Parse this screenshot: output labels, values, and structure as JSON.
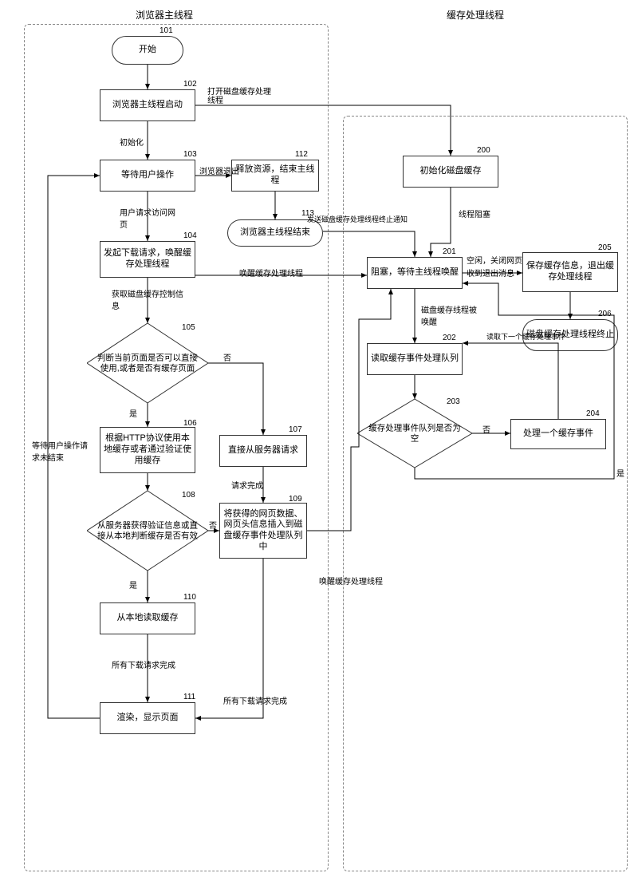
{
  "titles": {
    "left": "浏览器主线程",
    "right": "缓存处理线程"
  },
  "nodes": {
    "n101": "开始",
    "n102": "浏览器主线程启动",
    "n103": "等待用户操作",
    "n104": "发起下载请求，唤醒缓存处理线程",
    "n105": "判断当前页面是否可以直接使用,或者是否有缓存页面",
    "n106": "根据HTTP协议使用本地缓存或者通过验证使用缓存",
    "n107": "直接从服务器请求",
    "n108": "从服务器获得验证信息或直接从本地判断缓存是否有效",
    "n109": "将获得的网页数据、网页头信息插入到磁盘缓存事件处理队列中",
    "n110": "从本地读取缓存",
    "n111": "渲染，显示页面",
    "n112": "释放资源，结束主线程",
    "n113": "浏览器主线程结束",
    "n200": "初始化磁盘缓存",
    "n201": "阻塞，等待主线程唤醒",
    "n202": "读取缓存事件处理队列",
    "n203": "缓存处理事件队列是否为空",
    "n204": "处理一个缓存事件",
    "n205": "保存缓存信息，退出缓存处理线程",
    "n206": "磁盘缓存处理线程终止"
  },
  "nums": {
    "n101": "101",
    "n102": "102",
    "n103": "103",
    "n104": "104",
    "n105": "105",
    "n106": "106",
    "n107": "107",
    "n108": "108",
    "n109": "109",
    "n110": "110",
    "n111": "111",
    "n112": "112",
    "n113": "113",
    "n200": "200",
    "n201": "201",
    "n202": "202",
    "n203": "203",
    "n204": "204",
    "n205": "205",
    "n206": "206"
  },
  "edges": {
    "e_init": "初始化",
    "e_browser_exit": "浏览器退出",
    "e_open_cache_thread": "打开磁盘缓存处理线程",
    "e_user_req": "用户请求访问网页",
    "e_get_cache_ctrl": "获取磁盘缓存控制信息",
    "e_yes": "是",
    "e_no": "否",
    "e_req_done": "请求完成",
    "e_all_done1": "所有下载请求完成",
    "e_all_done2": "所有下载请求完成",
    "e_wait_user": "等待用户操作请求未结束",
    "e_thread_block": "线程阻塞",
    "e_free_close": "空闲，关闭网页",
    "e_recv_exit": "收到退出消息",
    "e_wake_handler": "唤醒缓存处理线程",
    "e_wake_handler2": "唤醒缓存处理线程",
    "e_send_exit": "发送磁盘缓存处理线程终止通知",
    "e_get_next": "读取下一个缓存处理事件",
    "e_cache_wake": "磁盘缓存线程被唤醒"
  },
  "chart_data": {
    "type": "flowchart-dual-swimlane",
    "swimlanes": [
      "浏览器主线程",
      "缓存处理线程"
    ],
    "nodes": [
      {
        "id": 101,
        "lane": 0,
        "type": "start",
        "label": "开始"
      },
      {
        "id": 102,
        "lane": 0,
        "type": "process",
        "label": "浏览器主线程启动"
      },
      {
        "id": 103,
        "lane": 0,
        "type": "process",
        "label": "等待用户操作"
      },
      {
        "id": 104,
        "lane": 0,
        "type": "process",
        "label": "发起下载请求，唤醒缓存处理线程"
      },
      {
        "id": 105,
        "lane": 0,
        "type": "decision",
        "label": "判断当前页面是否可以直接使用,或者是否有缓存页面"
      },
      {
        "id": 106,
        "lane": 0,
        "type": "process",
        "label": "根据HTTP协议使用本地缓存或者通过验证使用缓存"
      },
      {
        "id": 107,
        "lane": 0,
        "type": "process",
        "label": "直接从服务器请求"
      },
      {
        "id": 108,
        "lane": 0,
        "type": "decision",
        "label": "从服务器获得验证信息或直接从本地判断缓存是否有效"
      },
      {
        "id": 109,
        "lane": 0,
        "type": "process",
        "label": "将获得的网页数据、网页头信息插入到磁盘缓存事件处理队列中"
      },
      {
        "id": 110,
        "lane": 0,
        "type": "process",
        "label": "从本地读取缓存"
      },
      {
        "id": 111,
        "lane": 0,
        "type": "process",
        "label": "渲染，显示页面"
      },
      {
        "id": 112,
        "lane": 0,
        "type": "process",
        "label": "释放资源，结束主线程"
      },
      {
        "id": 113,
        "lane": 0,
        "type": "end",
        "label": "浏览器主线程结束"
      },
      {
        "id": 200,
        "lane": 1,
        "type": "process",
        "label": "初始化磁盘缓存"
      },
      {
        "id": 201,
        "lane": 1,
        "type": "process",
        "label": "阻塞，等待主线程唤醒"
      },
      {
        "id": 202,
        "lane": 1,
        "type": "process",
        "label": "读取缓存事件处理队列"
      },
      {
        "id": 203,
        "lane": 1,
        "type": "decision",
        "label": "缓存处理事件队列是否为空"
      },
      {
        "id": 204,
        "lane": 1,
        "type": "process",
        "label": "处理一个缓存事件"
      },
      {
        "id": 205,
        "lane": 1,
        "type": "process",
        "label": "保存缓存信息，退出缓存处理线程"
      },
      {
        "id": 206,
        "lane": 1,
        "type": "end",
        "label": "磁盘缓存处理线程终止"
      }
    ],
    "edges": [
      {
        "from": 101,
        "to": 102
      },
      {
        "from": 102,
        "to": 103,
        "label": "初始化"
      },
      {
        "from": 102,
        "to": 200,
        "label": "打开磁盘缓存处理线程"
      },
      {
        "from": 103,
        "to": 104,
        "label": "用户请求访问网页"
      },
      {
        "from": 103,
        "to": 112,
        "label": "浏览器退出"
      },
      {
        "from": 112,
        "to": 113
      },
      {
        "from": 113,
        "to": 201,
        "label": "发送磁盘缓存处理线程终止通知"
      },
      {
        "from": 104,
        "to": 105,
        "label": "获取磁盘缓存控制信息"
      },
      {
        "from": 104,
        "to": 201,
        "label": "唤醒缓存处理线程"
      },
      {
        "from": 105,
        "to": 106,
        "label": "是"
      },
      {
        "from": 105,
        "to": 107,
        "label": "否"
      },
      {
        "from": 106,
        "to": 108
      },
      {
        "from": 107,
        "to": 109,
        "label": "请求完成"
      },
      {
        "from": 108,
        "to": 110,
        "label": "是"
      },
      {
        "from": 108,
        "to": 109,
        "label": "否"
      },
      {
        "from": 109,
        "to": 201,
        "label": "唤醒缓存处理线程"
      },
      {
        "from": 110,
        "to": 111,
        "label": "所有下载请求完成"
      },
      {
        "from": 109,
        "to": 111,
        "label": "所有下载请求完成"
      },
      {
        "from": 111,
        "to": 103,
        "label": "等待用户操作请求未结束"
      },
      {
        "from": 200,
        "to": 201,
        "label": "线程阻塞"
      },
      {
        "from": 201,
        "to": 202,
        "label": "磁盘缓存线程被唤醒"
      },
      {
        "from": 201,
        "to": 205,
        "label": "空闲，关闭网页 / 收到退出消息"
      },
      {
        "from": 202,
        "to": 203
      },
      {
        "from": 203,
        "to": 201,
        "label": "是"
      },
      {
        "from": 203,
        "to": 204,
        "label": "否"
      },
      {
        "from": 204,
        "to": 202,
        "label": "读取下一个缓存处理事件"
      },
      {
        "from": 205,
        "to": 206
      }
    ]
  }
}
